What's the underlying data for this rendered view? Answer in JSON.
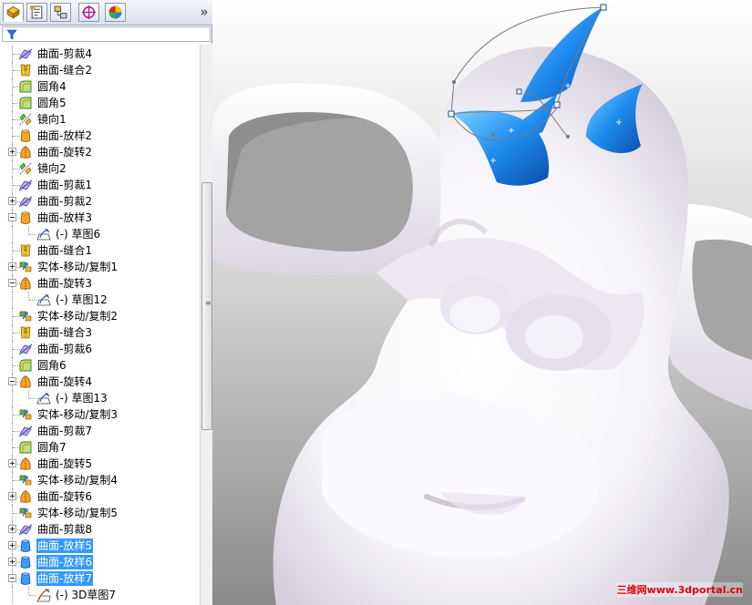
{
  "panel": {
    "tabs": [
      {
        "name": "feature-manager-tab-icon"
      },
      {
        "name": "property-manager-tab-icon"
      },
      {
        "name": "configuration-manager-tab-icon"
      },
      {
        "name": "dimxpert-manager-tab-icon"
      },
      {
        "name": "display-manager-tab-icon"
      }
    ],
    "collapse_label": "»",
    "filter_icon": "filter-icon"
  },
  "tree": {
    "items": [
      {
        "label": "曲面-剪裁4",
        "icon": "surface-trim-icon",
        "level": 0,
        "expander": "none"
      },
      {
        "label": "曲面-缝合2",
        "icon": "surface-knit-icon",
        "level": 0,
        "expander": "none"
      },
      {
        "label": "圆角4",
        "icon": "fillet-icon",
        "level": 0,
        "expander": "none"
      },
      {
        "label": "圆角5",
        "icon": "fillet-icon",
        "level": 0,
        "expander": "none"
      },
      {
        "label": "镜向1",
        "icon": "mirror-icon",
        "level": 0,
        "expander": "none"
      },
      {
        "label": "曲面-放样2",
        "icon": "surface-loft-icon",
        "level": 0,
        "expander": "none"
      },
      {
        "label": "曲面-旋转2",
        "icon": "surface-revolve-icon",
        "level": 0,
        "expander": "plus"
      },
      {
        "label": "镜向2",
        "icon": "mirror-icon",
        "level": 0,
        "expander": "none"
      },
      {
        "label": "曲面-剪裁1",
        "icon": "surface-trim-icon",
        "level": 0,
        "expander": "none"
      },
      {
        "label": "曲面-剪裁2",
        "icon": "surface-trim-icon",
        "level": 0,
        "expander": "plus"
      },
      {
        "label": "曲面-放样3",
        "icon": "surface-loft-icon",
        "level": 0,
        "expander": "minus"
      },
      {
        "label": "(-) 草图6",
        "icon": "sketch-icon",
        "level": 1,
        "expander": "none"
      },
      {
        "label": "曲面-缝合1",
        "icon": "surface-knit-icon",
        "level": 0,
        "expander": "none"
      },
      {
        "label": "实体-移动/复制1",
        "icon": "move-copy-icon",
        "level": 0,
        "expander": "plus"
      },
      {
        "label": "曲面-旋转3",
        "icon": "surface-revolve-icon",
        "level": 0,
        "expander": "minus"
      },
      {
        "label": "(-) 草图12",
        "icon": "sketch-icon",
        "level": 1,
        "expander": "none"
      },
      {
        "label": "实体-移动/复制2",
        "icon": "move-copy-icon",
        "level": 0,
        "expander": "none"
      },
      {
        "label": "曲面-缝合3",
        "icon": "surface-knit-icon",
        "level": 0,
        "expander": "none"
      },
      {
        "label": "曲面-剪裁6",
        "icon": "surface-trim-icon",
        "level": 0,
        "expander": "none"
      },
      {
        "label": "圆角6",
        "icon": "fillet-icon",
        "level": 0,
        "expander": "none"
      },
      {
        "label": "曲面-旋转4",
        "icon": "surface-revolve-icon",
        "level": 0,
        "expander": "minus"
      },
      {
        "label": "(-) 草图13",
        "icon": "sketch-icon",
        "level": 1,
        "expander": "none"
      },
      {
        "label": "实体-移动/复制3",
        "icon": "move-copy-icon",
        "level": 0,
        "expander": "none"
      },
      {
        "label": "曲面-剪裁7",
        "icon": "surface-trim-icon",
        "level": 0,
        "expander": "none"
      },
      {
        "label": "圆角7",
        "icon": "fillet-icon",
        "level": 0,
        "expander": "none"
      },
      {
        "label": "曲面-旋转5",
        "icon": "surface-revolve-icon",
        "level": 0,
        "expander": "plus"
      },
      {
        "label": "实体-移动/复制4",
        "icon": "move-copy-icon",
        "level": 0,
        "expander": "none"
      },
      {
        "label": "曲面-旋转6",
        "icon": "surface-revolve-icon",
        "level": 0,
        "expander": "plus"
      },
      {
        "label": "实体-移动/复制5",
        "icon": "move-copy-icon",
        "level": 0,
        "expander": "none"
      },
      {
        "label": "曲面-剪裁8",
        "icon": "surface-trim-icon",
        "level": 0,
        "expander": "plus"
      },
      {
        "label": "曲面-放样5",
        "icon": "surface-loft-selected-icon",
        "level": 0,
        "expander": "plus",
        "selected": true
      },
      {
        "label": "曲面-放样6",
        "icon": "surface-loft-selected-icon",
        "level": 0,
        "expander": "plus",
        "selected": true
      },
      {
        "label": "曲面-放样7",
        "icon": "surface-loft-selected-icon",
        "level": 0,
        "expander": "minus",
        "selected": true
      },
      {
        "label": "(-) 3D草图7",
        "icon": "3d-sketch-icon",
        "level": 1,
        "expander": "none"
      }
    ]
  },
  "splitter": {
    "icon": "splitter-collapse-icon"
  },
  "viewport": {
    "watermark": "三维网www.3dportal.cn",
    "colors": {
      "model": "#f7f4fa",
      "horns": "#1e8cf0",
      "selection": "#3399ff",
      "watermark": "#e0000b"
    }
  }
}
